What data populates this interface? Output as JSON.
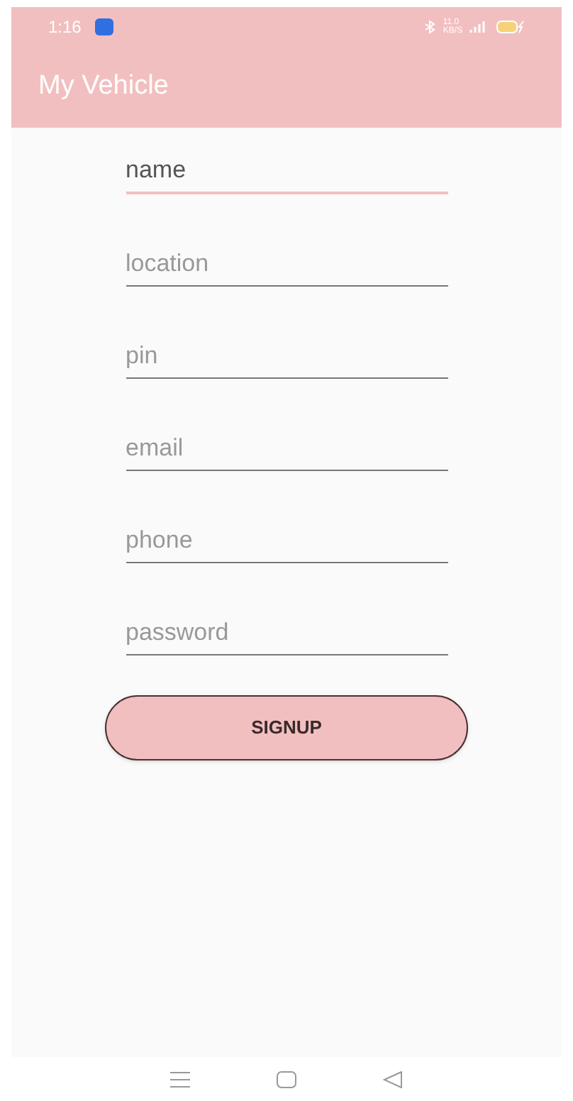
{
  "status_bar": {
    "time": "1:16",
    "speed_value": "11.0",
    "speed_unit": "KB/S"
  },
  "app_bar": {
    "title": "My Vehicle"
  },
  "fields": [
    {
      "placeholder": "name",
      "focused": true
    },
    {
      "placeholder": "location",
      "focused": false
    },
    {
      "placeholder": "pin",
      "focused": false
    },
    {
      "placeholder": "email",
      "focused": false
    },
    {
      "placeholder": "phone",
      "focused": false
    },
    {
      "placeholder": "password",
      "focused": false
    }
  ],
  "button": {
    "label": "SIGNUP"
  }
}
